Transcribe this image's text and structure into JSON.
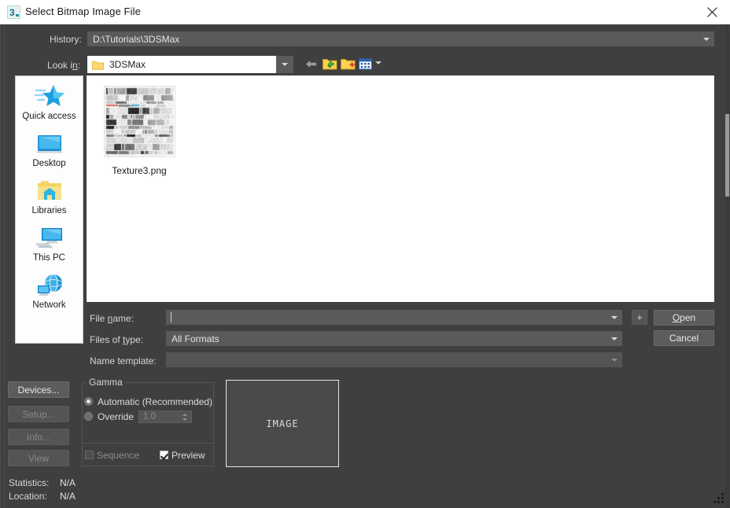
{
  "window": {
    "title": "Select Bitmap Image File",
    "app_icon": "3dsmax-icon",
    "close_label": "✕"
  },
  "toolbar": {
    "history_label": "History:",
    "history_value": "D:\\Tutorials\\3DSMax",
    "lookin_label": "Look in:",
    "lookin_value": "3DSMax",
    "buttons": [
      {
        "name": "back-button",
        "icon": "back-arrow-icon",
        "tip": "Back"
      },
      {
        "name": "up-one-level-button",
        "icon": "up-folder-icon",
        "tip": "Up One Level"
      },
      {
        "name": "create-new-folder-button",
        "icon": "new-folder-icon",
        "tip": "Create New Folder"
      },
      {
        "name": "views-button",
        "icon": "views-icon",
        "tip": "Views"
      }
    ]
  },
  "places": [
    {
      "label": "Quick access",
      "icon": "quick-access-star-icon"
    },
    {
      "label": "Desktop",
      "icon": "desktop-monitor-icon"
    },
    {
      "label": "Libraries",
      "icon": "libraries-folder-icon"
    },
    {
      "label": "This PC",
      "icon": "this-pc-icon"
    },
    {
      "label": "Network",
      "icon": "network-globe-icon"
    }
  ],
  "files": [
    {
      "name": "Texture3.png",
      "icon": "image-thumbnail"
    }
  ],
  "form": {
    "filename_label": "File name:",
    "filename_label_pre": "File ",
    "filename_label_accel": "n",
    "filename_label_post": "ame:",
    "filename_value": "",
    "filename_placeholder": "",
    "filetype_label_pre": "Files of ",
    "filetype_label_accel": "t",
    "filetype_label_post": "ype:",
    "filetype_value": "All Formats",
    "nametemplate_label": "Name template:",
    "nametemplate_value": ""
  },
  "actions": {
    "add_label": "+",
    "open_pre": "",
    "open_accel": "O",
    "open_post": "pen",
    "open_label": "Open",
    "cancel_label": "Cancel",
    "devices_label": "Devices...",
    "setup_label": "Setup...",
    "info_label": "Info...",
    "view_label": "View"
  },
  "gamma": {
    "title": "Gamma",
    "automatic_label": "Automatic (Recommended)",
    "automatic_selected": true,
    "override_label": "Override",
    "override_selected": false,
    "override_value": "1.0",
    "sequence_label": "Sequence",
    "sequence_checked": false,
    "preview_label": "Preview",
    "preview_checked": true
  },
  "preview": {
    "placeholder_text": "IMAGE"
  },
  "status": {
    "statistics_label": "Statistics:",
    "statistics_value": "N/A",
    "location_label": "Location:",
    "location_value": "N/A"
  },
  "colors": {
    "dialog_bg": "#3f3f3f",
    "field_bg": "#5a5a5a",
    "button_bg": "#5c5c5c",
    "titlebar_bg": "#ffffff",
    "list_bg": "#ffffff",
    "text": "#e0e0e0",
    "disabled_text": "#888888"
  }
}
